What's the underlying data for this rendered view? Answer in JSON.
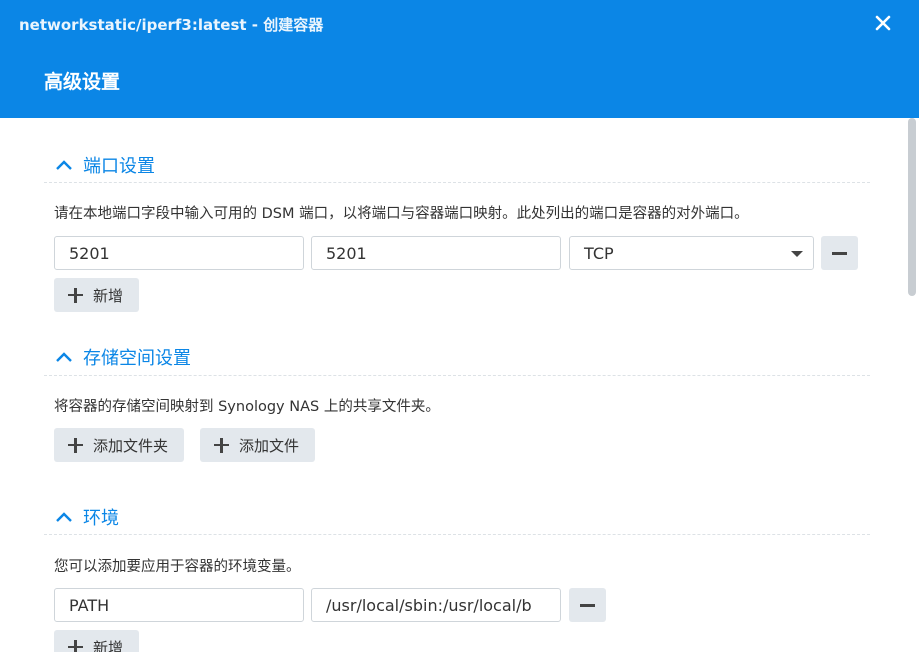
{
  "window": {
    "title": "networkstatic/iperf3:latest - 创建容器"
  },
  "page": {
    "title": "高级设置"
  },
  "port_section": {
    "label": "端口设置",
    "description": "请在本地端口字段中输入可用的 DSM 端口，以将端口与容器端口映射。此处列出的端口是容器的对外端口。",
    "rows": [
      {
        "local_port": "5201",
        "container_port": "5201",
        "protocol": "TCP"
      }
    ],
    "add_label": "新增"
  },
  "storage_section": {
    "label": "存储空间设置",
    "description": "将容器的存储空间映射到 Synology NAS 上的共享文件夹。",
    "add_folder_label": "添加文件夹",
    "add_file_label": "添加文件"
  },
  "env_section": {
    "label": "环境",
    "description": "您可以添加要应用于容器的环境变量。",
    "rows": [
      {
        "name": "PATH",
        "value": "/usr/local/sbin:/usr/local/b"
      }
    ],
    "add_label": "新增"
  },
  "colors": {
    "header": "#0b86e6",
    "accent": "#0b86e6",
    "button_bg": "#e3e8ed"
  }
}
